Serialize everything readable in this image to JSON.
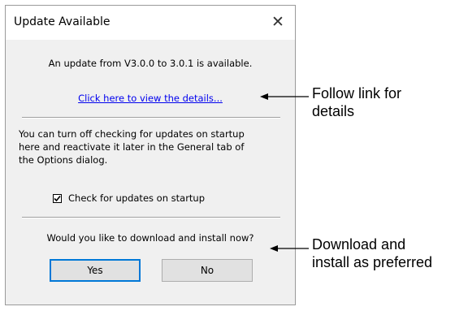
{
  "dialog": {
    "title": "Update Available",
    "close_glyph": "✕",
    "update_message": "An update from V3.0.0 to 3.0.1 is available.",
    "details_link": "Click here to view the details...",
    "info_lines": [
      "You can turn off checking for updates on startup",
      "here and reactivate it later in the General tab of",
      "the Options dialog."
    ],
    "checkbox": {
      "label": "Check for updates on startup",
      "checked": true
    },
    "question": "Would you like to download and install now?",
    "yes_label": "Yes",
    "no_label": "No"
  },
  "annotations": {
    "link_note_lines": [
      "Follow link for",
      "details"
    ],
    "install_note_lines": [
      "Download and",
      "install as preferred"
    ]
  }
}
